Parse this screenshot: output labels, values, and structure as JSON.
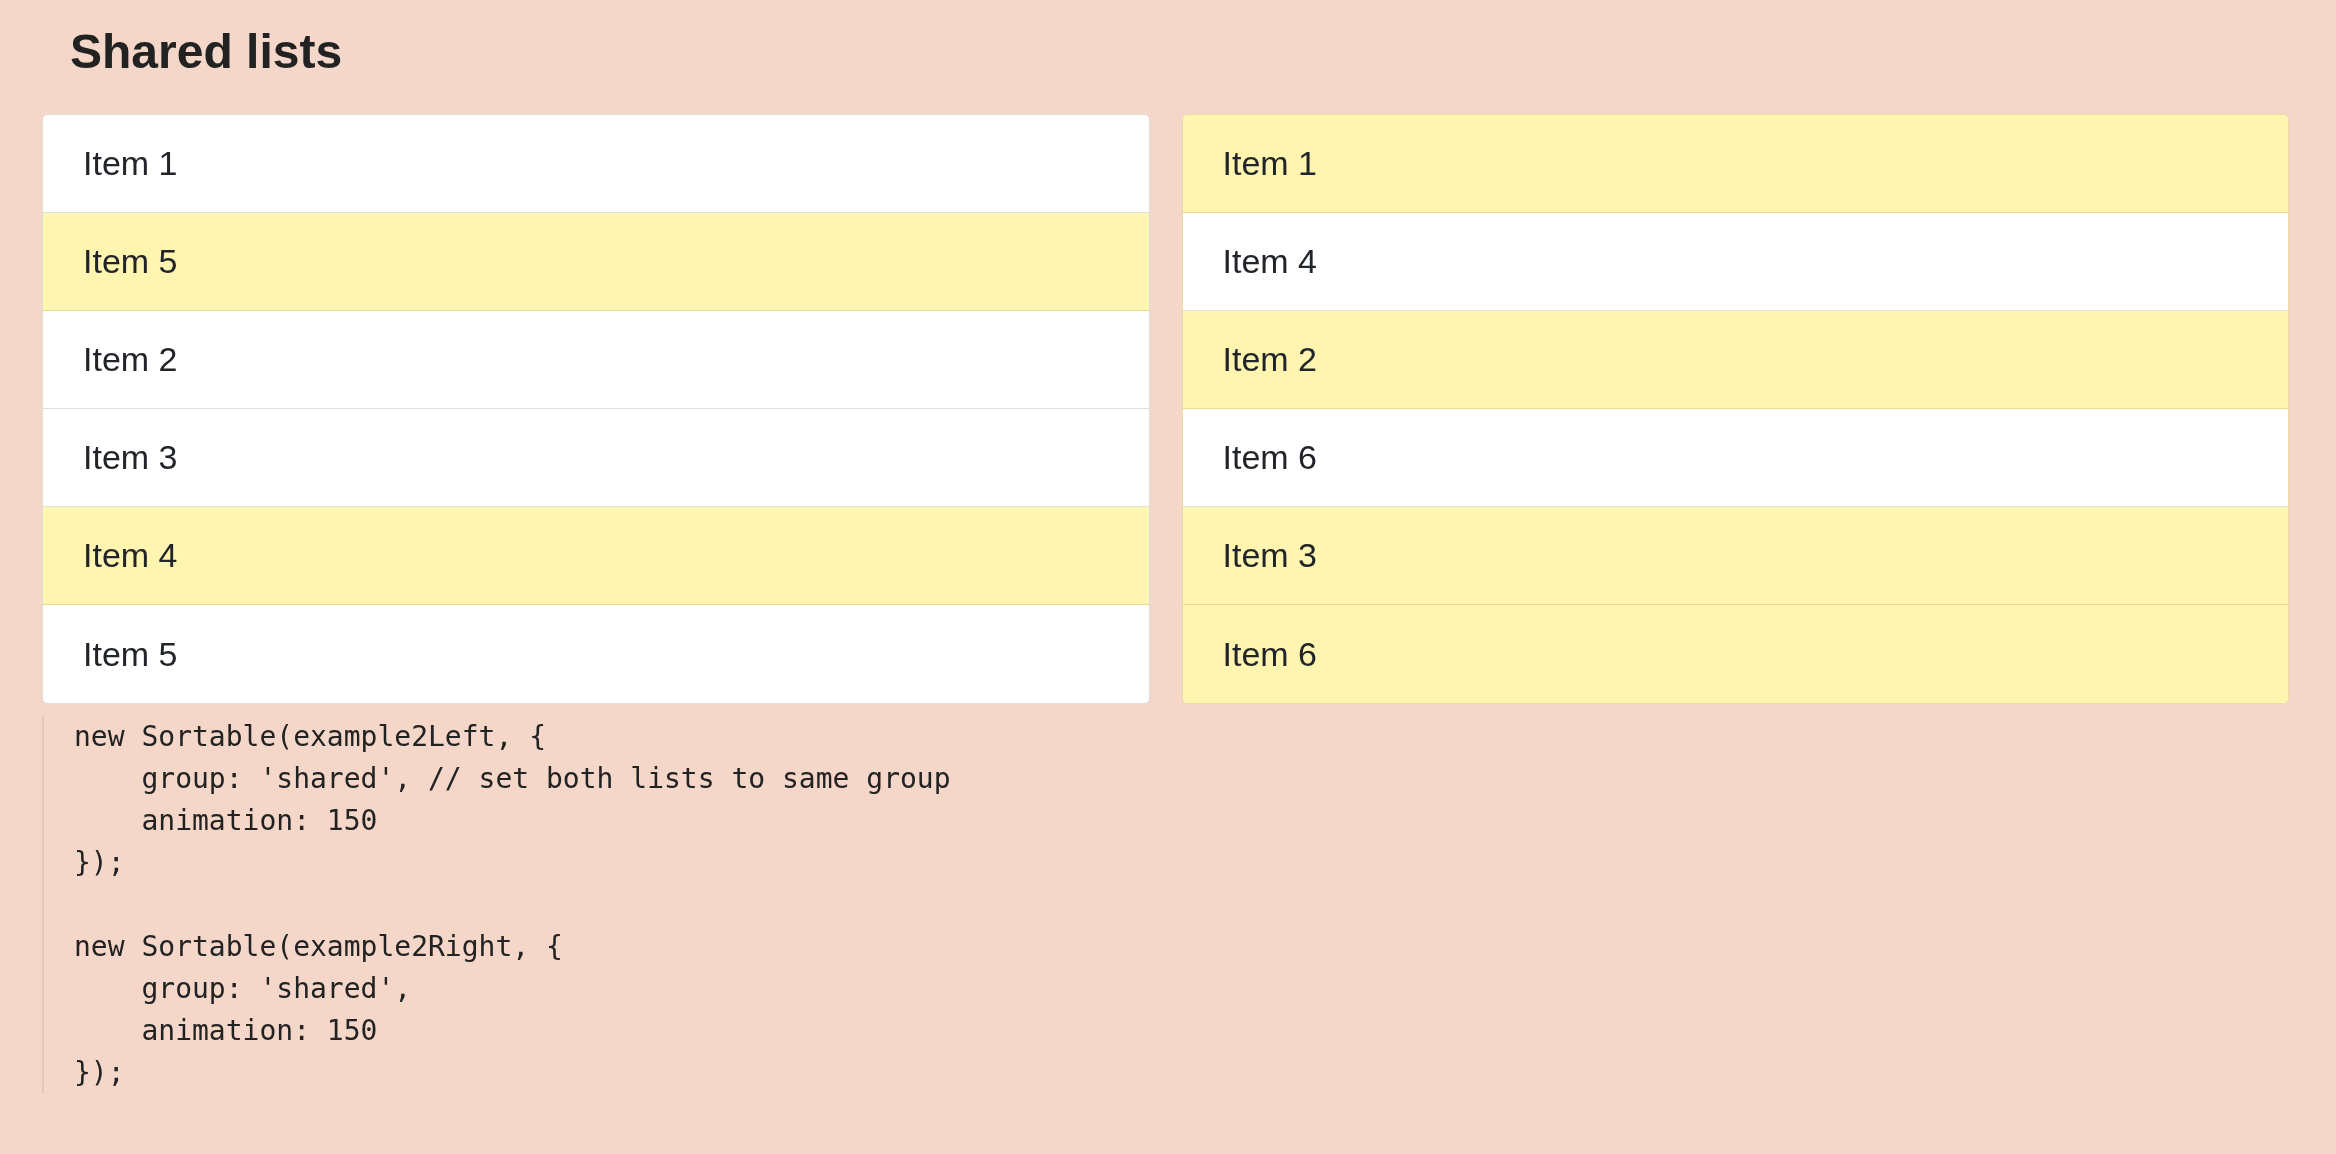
{
  "title": "Shared lists",
  "lists": [
    {
      "items": [
        {
          "label": "Item 1",
          "highlighted": false
        },
        {
          "label": "Item 5",
          "highlighted": true
        },
        {
          "label": "Item 2",
          "highlighted": false
        },
        {
          "label": "Item 3",
          "highlighted": false
        },
        {
          "label": "Item 4",
          "highlighted": true
        },
        {
          "label": "Item 5",
          "highlighted": false
        }
      ]
    },
    {
      "items": [
        {
          "label": "Item 1",
          "highlighted": true
        },
        {
          "label": "Item 4",
          "highlighted": false
        },
        {
          "label": "Item 2",
          "highlighted": true
        },
        {
          "label": "Item 6",
          "highlighted": false
        },
        {
          "label": "Item 3",
          "highlighted": true
        },
        {
          "label": "Item 6",
          "highlighted": true
        }
      ]
    }
  ],
  "code": "new Sortable(example2Left, {\n    group: 'shared', // set both lists to same group\n    animation: 150\n});\n\nnew Sortable(example2Right, {\n    group: 'shared',\n    animation: 150\n});"
}
